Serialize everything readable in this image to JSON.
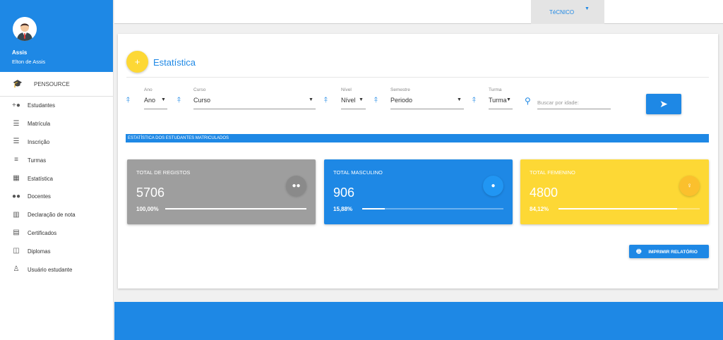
{
  "profile": {
    "short_name": "Assis",
    "full_name": "Elton de Assis"
  },
  "brand": {
    "label": "PENSOURCE",
    "icon": "graduation-cap-icon"
  },
  "sidebar": {
    "items": [
      {
        "label": "Estudantes",
        "icon": "add-person-icon"
      },
      {
        "label": "Matrícula",
        "icon": "list-numbered-icon"
      },
      {
        "label": "Inscrição",
        "icon": "list-icon"
      },
      {
        "label": "Turmas",
        "icon": "menu-lines-icon"
      },
      {
        "label": "Estatística",
        "icon": "dashboard-icon"
      },
      {
        "label": "Docentes",
        "icon": "people-icon"
      },
      {
        "label": "Declaração de nota",
        "icon": "bar-chart-icon"
      },
      {
        "label": "Certificados",
        "icon": "document-icon"
      },
      {
        "label": "Diplomas",
        "icon": "library-icon"
      },
      {
        "label": "Usuário estudante",
        "icon": "person-outline-icon"
      }
    ]
  },
  "topbar": {
    "role": "TéCNICO"
  },
  "page": {
    "title": "Estatística",
    "add_symbol": "+"
  },
  "filters": {
    "ano": {
      "label": "Ano",
      "value": "Ano"
    },
    "curso": {
      "label": "Curso",
      "value": "Curso"
    },
    "nivel": {
      "label": "Nível",
      "value": "Nível"
    },
    "semestre": {
      "label": "Semestre",
      "value": "Periodo"
    },
    "turma": {
      "label": "Turma",
      "value": "Turma"
    },
    "search": {
      "placeholder": "Buscar por idade:"
    }
  },
  "banner": {
    "text": "ESTATÍSTICA DOS ESTUDANTES MATRICULADOS"
  },
  "stats": {
    "total": {
      "label": "TOTAL DE REGISTOS",
      "value": "5706",
      "percent": "100,00%",
      "fraction": 1.0,
      "icon": "group-icon"
    },
    "male": {
      "label": "TOTAL MASCULINO",
      "value": "906",
      "percent": "15,88%",
      "fraction": 0.1588,
      "icon": "person-icon"
    },
    "female": {
      "label": "TOTAL FEMENINO",
      "value": "4800",
      "percent": "84,12%",
      "fraction": 0.8412,
      "icon": "woman-icon"
    }
  },
  "actions": {
    "print_label": "IMPRIMIR RELATÓRIO"
  },
  "colors": {
    "primary": "#1e88e5",
    "accent": "#fdd835",
    "neutral": "#9e9e9e"
  }
}
